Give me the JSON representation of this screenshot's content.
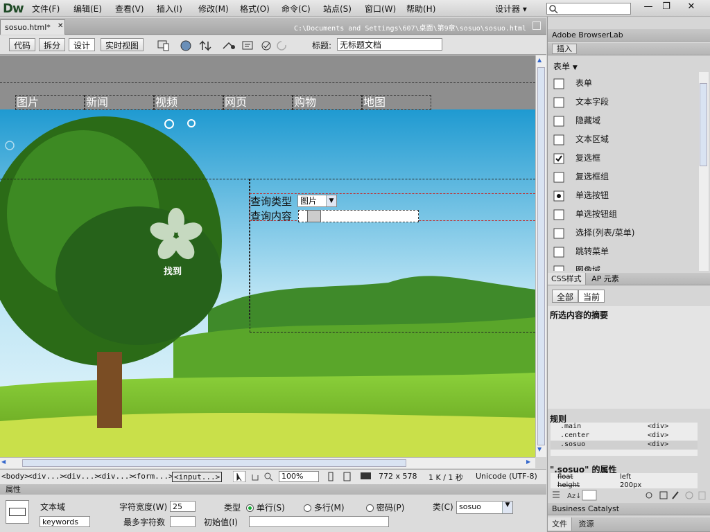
{
  "app": {
    "logo": "Dw",
    "workspace": "设计器 ▾",
    "win_min": "—",
    "win_max": "❐",
    "win_close": "✕"
  },
  "menu": [
    "文件(F)",
    "编辑(E)",
    "查看(V)",
    "插入(I)",
    "修改(M)",
    "格式(O)",
    "命令(C)",
    "站点(S)",
    "窗口(W)",
    "帮助(H)"
  ],
  "document": {
    "tab_label": "sosuo.html*",
    "tab_close": "✕",
    "path": "C:\\Documents and Settings\\607\\桌面\\第9章\\sosuo\\sosuo.html"
  },
  "toolbar": {
    "views": [
      "代码",
      "拆分",
      "设计",
      "实时视图"
    ],
    "title_label": "标题:",
    "title_value": "无标题文档"
  },
  "canvas": {
    "nav": [
      "图片",
      "新闻",
      "视频",
      "网页",
      "购物",
      "地图"
    ],
    "brand_text": "找到",
    "query_type_label": "查询类型",
    "query_type_value": "图片",
    "query_content_label": "查询内容"
  },
  "statusbar": {
    "tags": [
      "<body>",
      "<div...>",
      "<div...>",
      "<div...>",
      "<form...>",
      "<input...>"
    ],
    "zoom": "100%",
    "size": "772 x 578",
    "weight": "1 K / 1 秒",
    "encoding": "Unicode (UTF-8)"
  },
  "properties": {
    "title": "属性",
    "type_name": "文本域",
    "name_value": "keywords",
    "char_width_label": "字符宽度(W)",
    "char_width_value": "25",
    "max_chars_label": "最多字符数",
    "max_chars_value": "",
    "init_value_label": "初始值(I)",
    "init_value": "",
    "type_label": "类型",
    "radio_single": "单行(S)",
    "radio_multi": "多行(M)",
    "radio_password": "密码(P)",
    "class_label": "类(C)",
    "class_value": "sosuo"
  },
  "panels": {
    "browserlab": "Adobe BrowserLab",
    "insert_tab": "插入",
    "insert_category": "表单",
    "insert_items": [
      {
        "label": "表单",
        "icon": "form-icon"
      },
      {
        "label": "文本字段",
        "icon": "text-field-icon"
      },
      {
        "label": "隐藏域",
        "icon": "hidden-field-icon"
      },
      {
        "label": "文本区域",
        "icon": "textarea-icon"
      },
      {
        "label": "复选框",
        "icon": "checkbox-icon"
      },
      {
        "label": "复选框组",
        "icon": "checkbox-group-icon"
      },
      {
        "label": "单选按钮",
        "icon": "radio-icon"
      },
      {
        "label": "单选按钮组",
        "icon": "radio-group-icon"
      },
      {
        "label": "选择(列表/菜单)",
        "icon": "select-icon"
      },
      {
        "label": "跳转菜单",
        "icon": "jump-menu-icon"
      },
      {
        "label": "图像域",
        "icon": "image-field-icon"
      }
    ],
    "css_tab": "CSS样式",
    "ap_tab": "AP 元素",
    "css_all": "全部",
    "css_current": "当前",
    "summary_title": "所选内容的摘要",
    "rules_title": "规则",
    "rules": [
      {
        "selector": ".main",
        "tag": "<div>"
      },
      {
        "selector": ".center",
        "tag": "<div>"
      },
      {
        "selector": ".sosuo",
        "tag": "<div>"
      }
    ],
    "props_title": "\".sosuo\" 的属性",
    "props_rows": [
      {
        "name": "float",
        "value": "left"
      },
      {
        "name": "height",
        "value": "200px"
      }
    ],
    "business_catalyst": "Business Catalyst",
    "files_tab": "文件",
    "assets_tab": "资源"
  }
}
